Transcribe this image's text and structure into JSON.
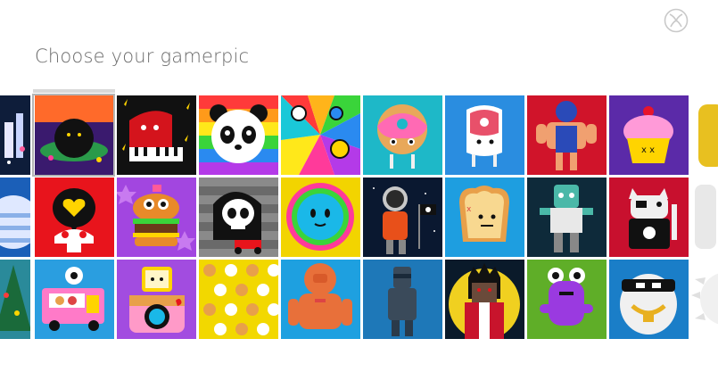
{
  "header": {
    "title": "Choose your gamerpic",
    "logo_icon": "xbox-logo-icon"
  },
  "selected_index": 1,
  "gamerpics": [
    {
      "row": 0,
      "col": 0,
      "name": "castle-night",
      "bg": "#0e1d3a"
    },
    {
      "row": 0,
      "col": 1,
      "name": "fuzzy-monster-planet",
      "bg": "#3a1a6e"
    },
    {
      "row": 0,
      "col": 2,
      "name": "red-piano",
      "bg": "#111111"
    },
    {
      "row": 0,
      "col": 3,
      "name": "rainbow-panda",
      "bg": "#ff3d8a"
    },
    {
      "row": 0,
      "col": 4,
      "name": "doodle-rainbow",
      "bg": "#ffffff"
    },
    {
      "row": 0,
      "col": 5,
      "name": "donut-character",
      "bg": "#1eb8c8"
    },
    {
      "row": 0,
      "col": 6,
      "name": "ham-character",
      "bg": "#2a8de0"
    },
    {
      "row": 0,
      "col": 7,
      "name": "wrestler",
      "bg": "#d0142a"
    },
    {
      "row": 0,
      "col": 8,
      "name": "cupcake",
      "bg": "#5b2aa8"
    },
    {
      "row": 0,
      "col": 9,
      "name": "yellow-figure",
      "bg": "#ffffff"
    },
    {
      "row": 1,
      "col": 0,
      "name": "striped-planet",
      "bg": "#1b5fb8"
    },
    {
      "row": 1,
      "col": 1,
      "name": "heart-bubble",
      "bg": "#e8141c"
    },
    {
      "row": 1,
      "col": 2,
      "name": "burger-monster",
      "bg": "#a246e0"
    },
    {
      "row": 1,
      "col": 3,
      "name": "reaper-skull",
      "bg": "#7a7a7a"
    },
    {
      "row": 1,
      "col": 4,
      "name": "sun-face",
      "bg": "#f2d400"
    },
    {
      "row": 1,
      "col": 5,
      "name": "astronaut",
      "bg": "#0a1830"
    },
    {
      "row": 1,
      "col": 6,
      "name": "toast-character",
      "bg": "#1e9ee0"
    },
    {
      "row": 1,
      "col": 7,
      "name": "zombie",
      "bg": "#0e2a3a"
    },
    {
      "row": 1,
      "col": 8,
      "name": "punk-cat",
      "bg": "#c8102e"
    },
    {
      "row": 1,
      "col": 9,
      "name": "white-figure",
      "bg": "#ffffff"
    },
    {
      "row": 2,
      "col": 0,
      "name": "christmas-tree",
      "bg": "#2a8a9a"
    },
    {
      "row": 2,
      "col": 1,
      "name": "food-truck",
      "bg": "#2a9ee0"
    },
    {
      "row": 2,
      "col": 2,
      "name": "camera-character",
      "bg": "#a24ce0"
    },
    {
      "row": 2,
      "col": 3,
      "name": "emoji-pattern",
      "bg": "#f2d800"
    },
    {
      "row": 2,
      "col": 4,
      "name": "diver-robot",
      "bg": "#1ea0e0"
    },
    {
      "row": 2,
      "col": 5,
      "name": "bandit",
      "bg": "#1e78b8"
    },
    {
      "row": 2,
      "col": 6,
      "name": "vampire-moon",
      "bg": "#f0d020"
    },
    {
      "row": 2,
      "col": 7,
      "name": "purple-alien",
      "bg": "#5fae28"
    },
    {
      "row": 2,
      "col": 8,
      "name": "gold-chain-panda",
      "bg": "#1a7ec8"
    },
    {
      "row": 2,
      "col": 9,
      "name": "white-spiky",
      "bg": "#ffffff"
    }
  ]
}
